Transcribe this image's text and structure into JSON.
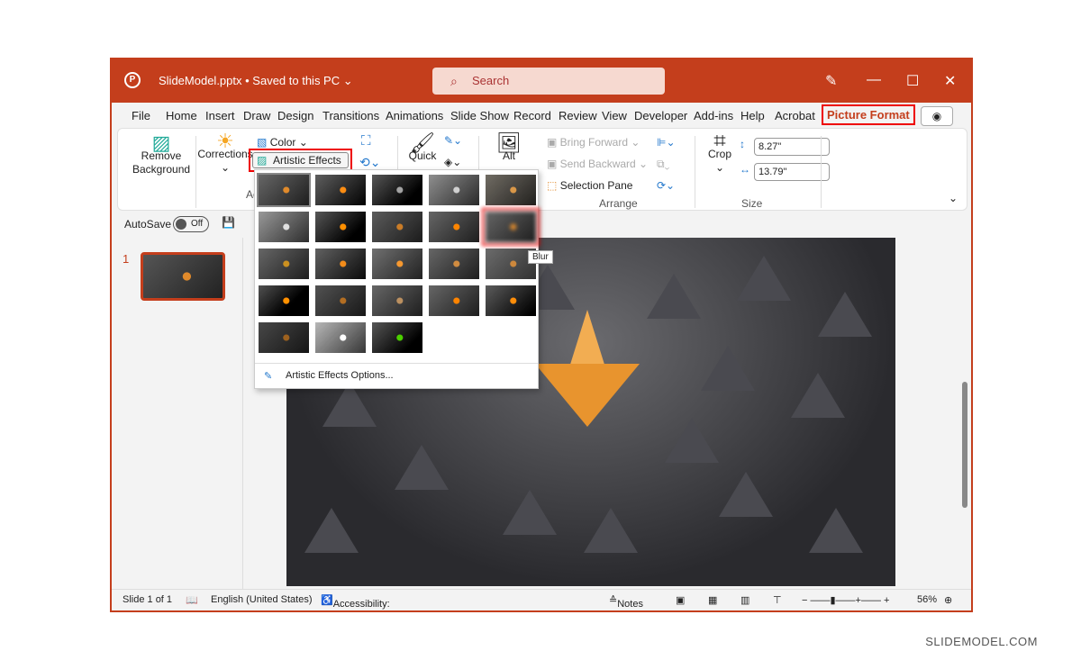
{
  "title": {
    "app_icon": "powerpoint-icon",
    "filename": "SlideModel.pptx",
    "saved": "• Saved to this PC",
    "search_placeholder": "Search"
  },
  "tabs": [
    "File",
    "Home",
    "Insert",
    "Draw",
    "Design",
    "Transitions",
    "Animations",
    "Slide Show",
    "Record",
    "Review",
    "View",
    "Developer",
    "Add-ins",
    "Help",
    "Acrobat",
    "Picture Format"
  ],
  "active_tab": "Picture Format",
  "ribbon": {
    "remove_bg": "Remove Background",
    "corrections": "Corrections",
    "color": "Color",
    "artistic": "Artistic Effects",
    "adjust_trunc": "Ac",
    "quick": "Quick",
    "alt": "Alt",
    "bring_forward": "Bring Forward",
    "send_backward": "Send Backward",
    "selection_pane": "Selection Pane",
    "arrange": "Arrange",
    "crop": "Crop",
    "height": "8.27\"",
    "width": "13.79\"",
    "size": "Size"
  },
  "qat": {
    "autosave": "AutoSave",
    "toggle": "Off"
  },
  "slide_number": "1",
  "gallery": {
    "tooltip": "Blur",
    "options": "Artistic Effects Options..."
  },
  "status": {
    "slide": "Slide 1 of 1",
    "language": "English (United States)",
    "accessibility": "Accessibility: Good to go",
    "notes": "Notes",
    "zoom": "56%"
  },
  "watermark": "SLIDEMODEL.COM",
  "colors": {
    "accent": "#c43e1c",
    "highlight": "#e00000"
  }
}
